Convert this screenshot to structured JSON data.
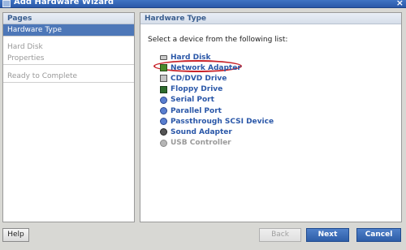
{
  "window": {
    "title": "Add Hardware Wizard",
    "close_glyph": "×"
  },
  "pages_panel": {
    "header": "Pages",
    "items": [
      {
        "label": "Hardware Type",
        "active": true
      },
      {
        "label": "Hard Disk",
        "active": false
      },
      {
        "label": "Properties",
        "active": false
      },
      {
        "label": "Ready to Complete",
        "active": false
      }
    ]
  },
  "hardware_panel": {
    "header": "Hardware Type",
    "instruction": "Select a device from the following list:",
    "devices": [
      {
        "label": "Hard Disk",
        "icon": "hard-disk-icon",
        "enabled": true
      },
      {
        "label": "Network Adapter",
        "icon": "network-adapter-icon",
        "enabled": true,
        "highlighted": true
      },
      {
        "label": "CD/DVD Drive",
        "icon": "cd-dvd-icon",
        "enabled": true
      },
      {
        "label": "Floppy Drive",
        "icon": "floppy-icon",
        "enabled": true
      },
      {
        "label": "Serial Port",
        "icon": "serial-port-icon",
        "enabled": true
      },
      {
        "label": "Parallel Port",
        "icon": "parallel-port-icon",
        "enabled": true
      },
      {
        "label": "Passthrough SCSI Device",
        "icon": "scsi-icon",
        "enabled": true
      },
      {
        "label": "Sound Adapter",
        "icon": "sound-adapter-icon",
        "enabled": true
      },
      {
        "label": "USB Controller",
        "icon": "usb-icon",
        "enabled": false
      }
    ]
  },
  "buttons": {
    "help": "Help",
    "back": "Back",
    "next": "Next",
    "cancel": "Cancel"
  },
  "colors": {
    "accent": "#2e5ea8",
    "link": "#2a57a8",
    "highlight_ellipse": "#c8232a"
  }
}
